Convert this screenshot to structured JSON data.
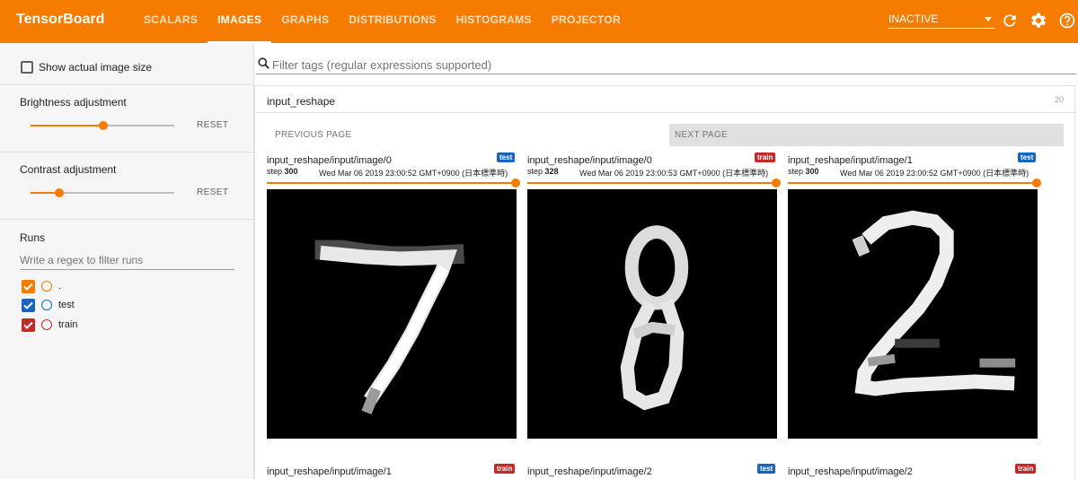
{
  "app": {
    "title": "TensorBoard"
  },
  "nav": {
    "tabs": [
      {
        "label": "SCALARS"
      },
      {
        "label": "IMAGES"
      },
      {
        "label": "GRAPHS"
      },
      {
        "label": "DISTRIBUTIONS"
      },
      {
        "label": "HISTOGRAMS"
      },
      {
        "label": "PROJECTOR"
      }
    ],
    "active_tab": "IMAGES",
    "inactive_select": "INACTIVE",
    "icons": [
      "refresh-icon",
      "gear-icon",
      "help-icon"
    ]
  },
  "colors": {
    "brand": "#f57c00",
    "run_dot": "#f57c00",
    "run_test": "#1565c0",
    "run_train": "#c62828"
  },
  "sidebar": {
    "show_actual_size": "Show actual image size",
    "brightness": {
      "label": "Brightness adjustment",
      "reset": "RESET",
      "value": 0.5
    },
    "contrast": {
      "label": "Contrast adjustment",
      "reset": "RESET",
      "value": 0.2
    },
    "runs": {
      "title": "Runs",
      "filter_placeholder": "Write a regex to filter runs",
      "items": [
        {
          "name": ".",
          "checked": true
        },
        {
          "name": "test",
          "checked": true
        },
        {
          "name": "train",
          "checked": true
        }
      ]
    }
  },
  "main": {
    "search_placeholder": "Filter tags (regular expressions supported)",
    "group": {
      "title": "input_reshape",
      "count": "20",
      "prev_page": "PREVIOUS PAGE",
      "next_page": "NEXT PAGE",
      "cards": [
        {
          "tag": "input_reshape/input/image/0",
          "run": "test",
          "step_label": "step",
          "step": "300",
          "time": "Wed Mar 06 2019 23:00:52 GMT+0900 (日本標準時)",
          "digit": "7"
        },
        {
          "tag": "input_reshape/input/image/0",
          "run": "train",
          "step_label": "step",
          "step": "328",
          "time": "Wed Mar 06 2019 23:00:53 GMT+0900 (日本標準時)",
          "digit": "8"
        },
        {
          "tag": "input_reshape/input/image/1",
          "run": "test",
          "step_label": "step",
          "step": "300",
          "time": "Wed Mar 06 2019 23:00:52 GMT+0900 (日本標準時)",
          "digit": "2"
        },
        {
          "tag": "input_reshape/input/image/1",
          "run": "train"
        },
        {
          "tag": "input_reshape/input/image/2",
          "run": "test"
        },
        {
          "tag": "input_reshape/input/image/2",
          "run": "train"
        }
      ]
    }
  }
}
